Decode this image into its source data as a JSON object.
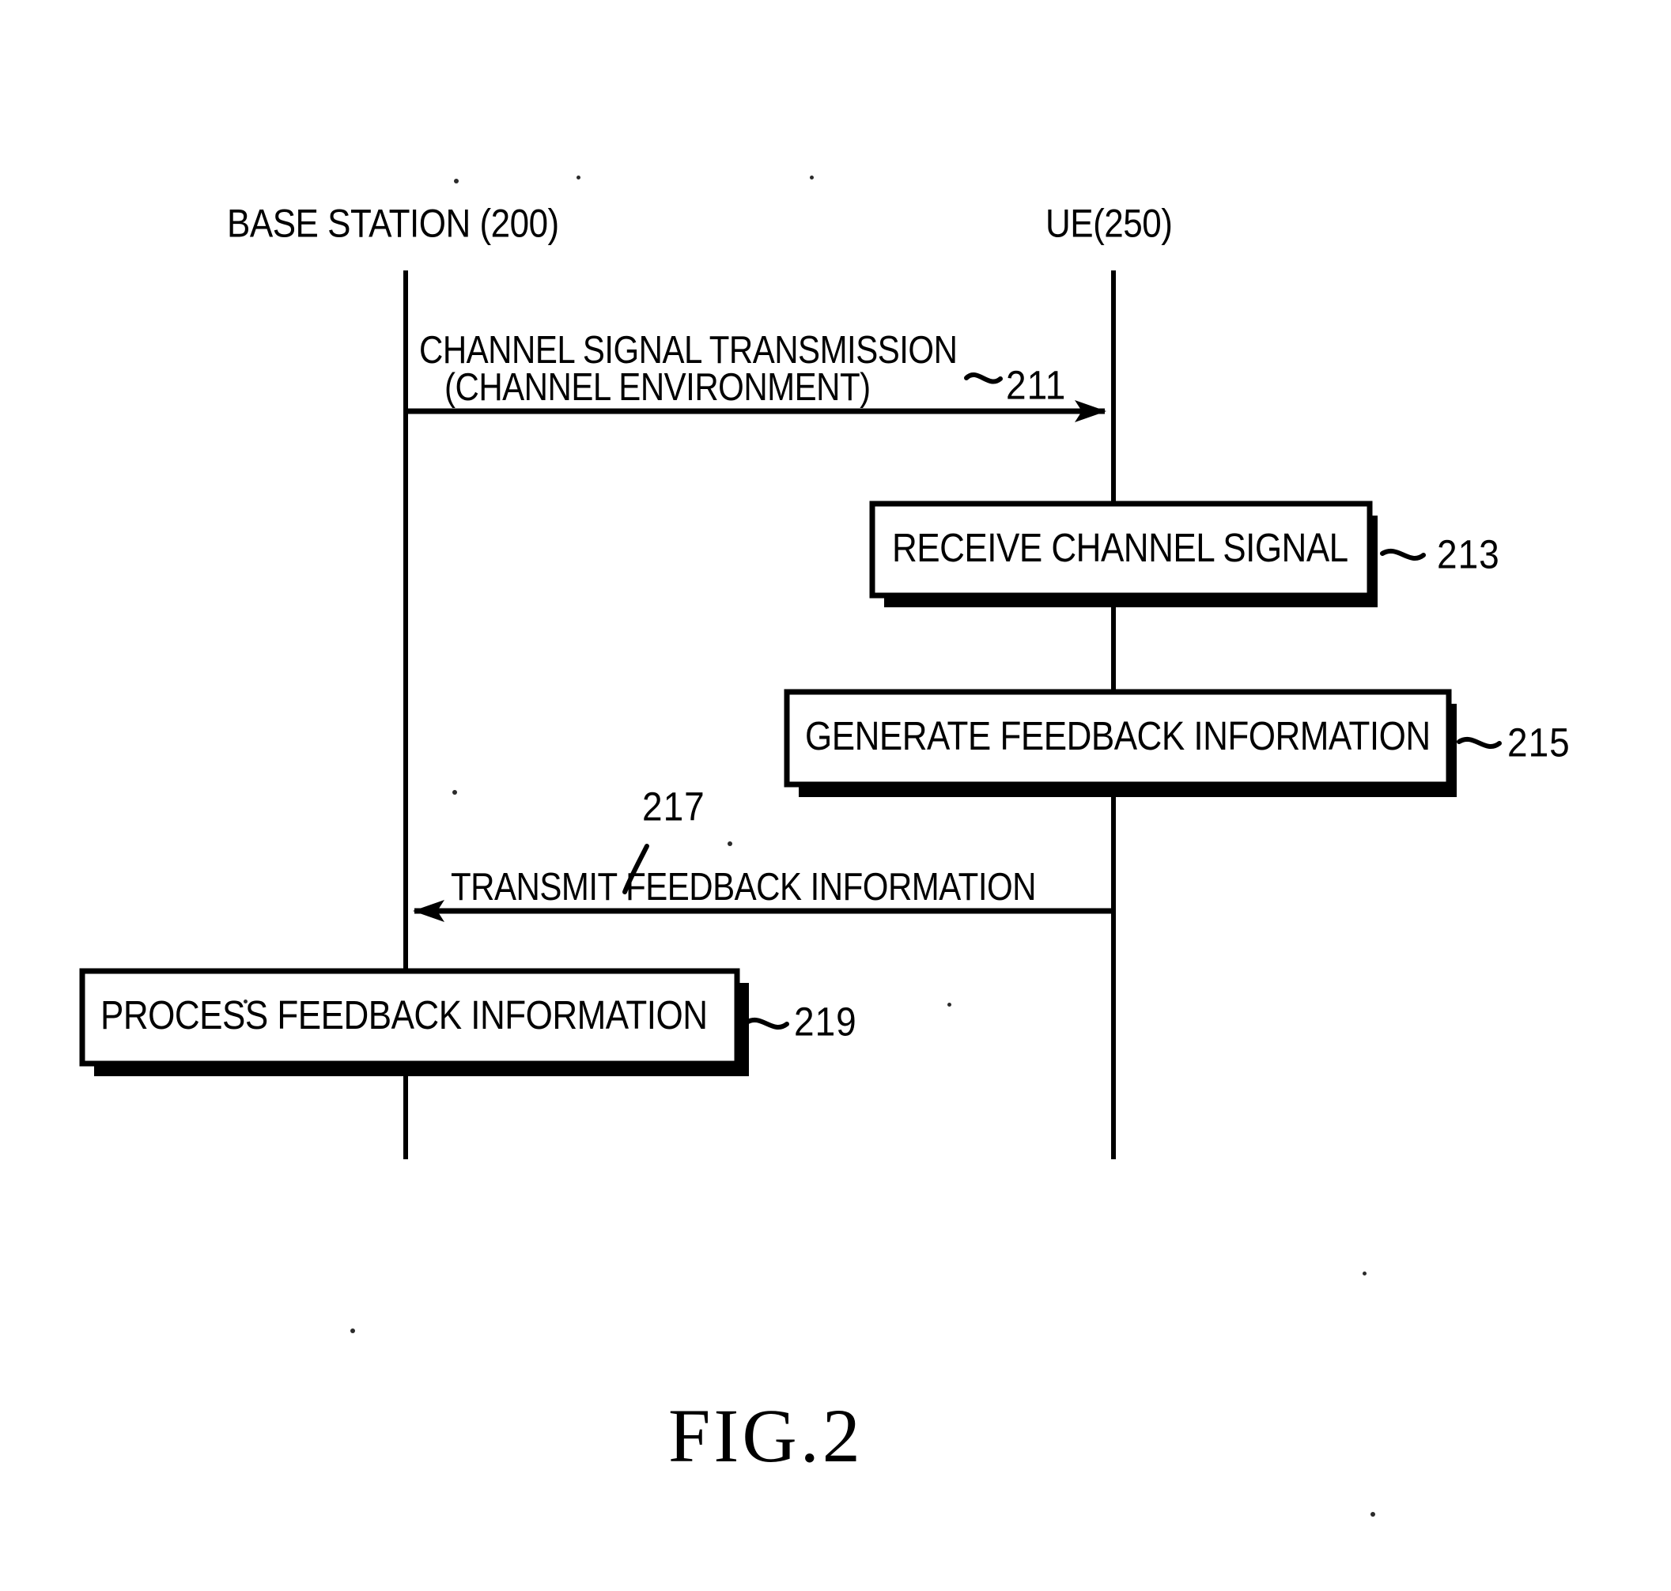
{
  "figure": {
    "caption": "FIG.2",
    "type": "sequence-diagram"
  },
  "actors": [
    {
      "id": "base-station",
      "label": "BASE STATION (200)",
      "reference": "200"
    },
    {
      "id": "ue",
      "label": "UE(250)",
      "reference": "250"
    }
  ],
  "messages": [
    {
      "id": "211",
      "reference": "211",
      "line1": "CHANNEL SIGNAL TRANSMISSION",
      "line2": "(CHANNEL ENVIRONMENT)",
      "from": "base-station",
      "to": "ue",
      "direction": "right"
    },
    {
      "id": "217",
      "reference": "217",
      "line1": "TRANSMIT FEEDBACK INFORMATION",
      "from": "ue",
      "to": "base-station",
      "direction": "left"
    }
  ],
  "steps": [
    {
      "id": "213",
      "reference": "213",
      "label": "RECEIVE CHANNEL SIGNAL",
      "actor": "ue"
    },
    {
      "id": "215",
      "reference": "215",
      "label": "GENERATE FEEDBACK INFORMATION",
      "actor": "ue"
    },
    {
      "id": "219",
      "reference": "219",
      "label": "PROCESS FEEDBACK INFORMATION",
      "actor": "base-station"
    }
  ],
  "colors": {
    "ink": "#000000",
    "paper": "#ffffff",
    "shadow": "#000000"
  }
}
